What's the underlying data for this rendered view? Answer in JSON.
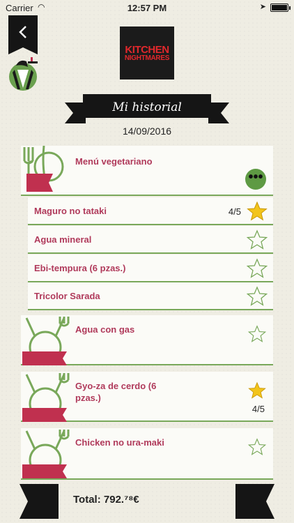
{
  "status": {
    "carrier": "Carrier",
    "time": "12:57 PM"
  },
  "header": {
    "logo_line1": "KITCHEN",
    "logo_line2": "NIGHTMARES",
    "title": "Mi historial",
    "date": "14/09/2016"
  },
  "menu_card": {
    "title": "Menú vegetariano",
    "more_label": "•••",
    "items": [
      {
        "name": "Maguro no tataki",
        "rating": "4/5",
        "starred": true
      },
      {
        "name": "Agua mineral",
        "rating": "",
        "starred": false
      },
      {
        "name": "Ebi-tempura (6 pzas.)",
        "rating": "",
        "starred": false
      },
      {
        "name": "Tricolor Sarada",
        "rating": "",
        "starred": false
      }
    ]
  },
  "orders": [
    {
      "name": "Agua con gas",
      "rating": "",
      "starred": false
    },
    {
      "name": "Gyo-za de cerdo (6 pzas.)",
      "rating": "4/5",
      "starred": true
    },
    {
      "name": "Chicken no ura-maki",
      "rating": "",
      "starred": false
    }
  ],
  "footer": {
    "total_label": "Total: 792.⁷⁸€"
  },
  "colors": {
    "accent_green": "#79a85a",
    "title_red": "#b03a5b",
    "star_gold": "#f2c41b",
    "banner_red": "#c0304f"
  }
}
